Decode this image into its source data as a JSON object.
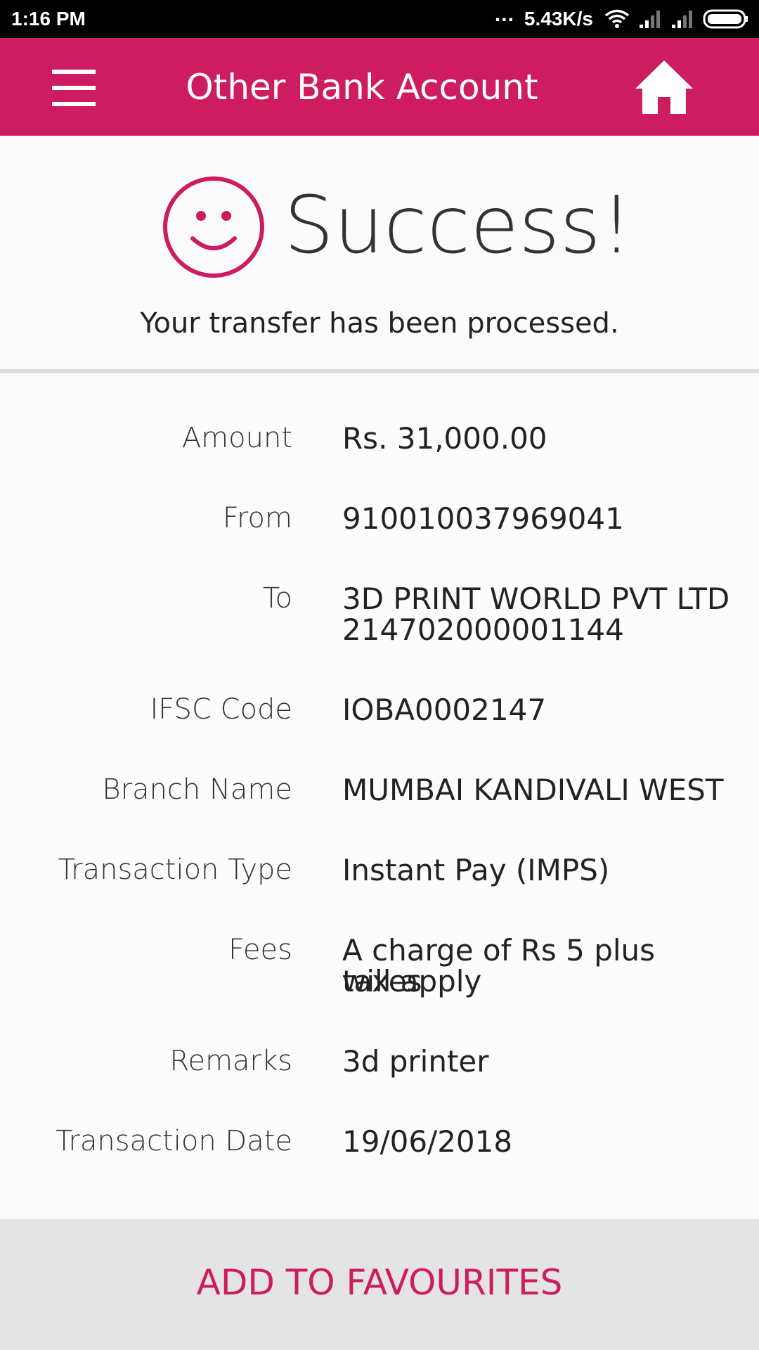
{
  "status_bar": {
    "time": "1:16 PM",
    "dots": "...",
    "network_speed": "5.43K/s",
    "icons": [
      "wifi-icon",
      "signal-icon",
      "signal-icon",
      "battery-icon"
    ]
  },
  "header": {
    "title": "Other Bank Account",
    "menu_icon": "hamburger-menu-icon",
    "home_icon": "home-icon",
    "background_color": "#cd1c5f"
  },
  "success": {
    "icon": "smiley-icon",
    "title": "Success!",
    "message": "Your transfer has been processed."
  },
  "details": [
    {
      "label": "Amount",
      "value": "Rs. 31,000.00"
    },
    {
      "label": "From",
      "value": "910010037969041"
    },
    {
      "label": "To",
      "value": "3D PRINT WORLD PVT LTD",
      "value_line2": "214702000001144"
    },
    {
      "label": "IFSC Code",
      "value": "IOBA0002147"
    },
    {
      "label": "Branch Name",
      "value": "MUMBAI KANDIVALI WEST"
    },
    {
      "label": "Transaction Type",
      "value": "Instant Pay (IMPS)"
    },
    {
      "label": "Fees",
      "value": "A charge of Rs 5 plus taxes",
      "value_line2": "will apply"
    },
    {
      "label": "Remarks",
      "value": "3d printer"
    },
    {
      "label": "Transaction Date",
      "value": "19/06/2018"
    }
  ],
  "footer": {
    "favourites_label": "ADD TO FAVOURITES"
  },
  "colors": {
    "accent": "#cd1c5f",
    "footer_bg": "#e4e4e4"
  }
}
